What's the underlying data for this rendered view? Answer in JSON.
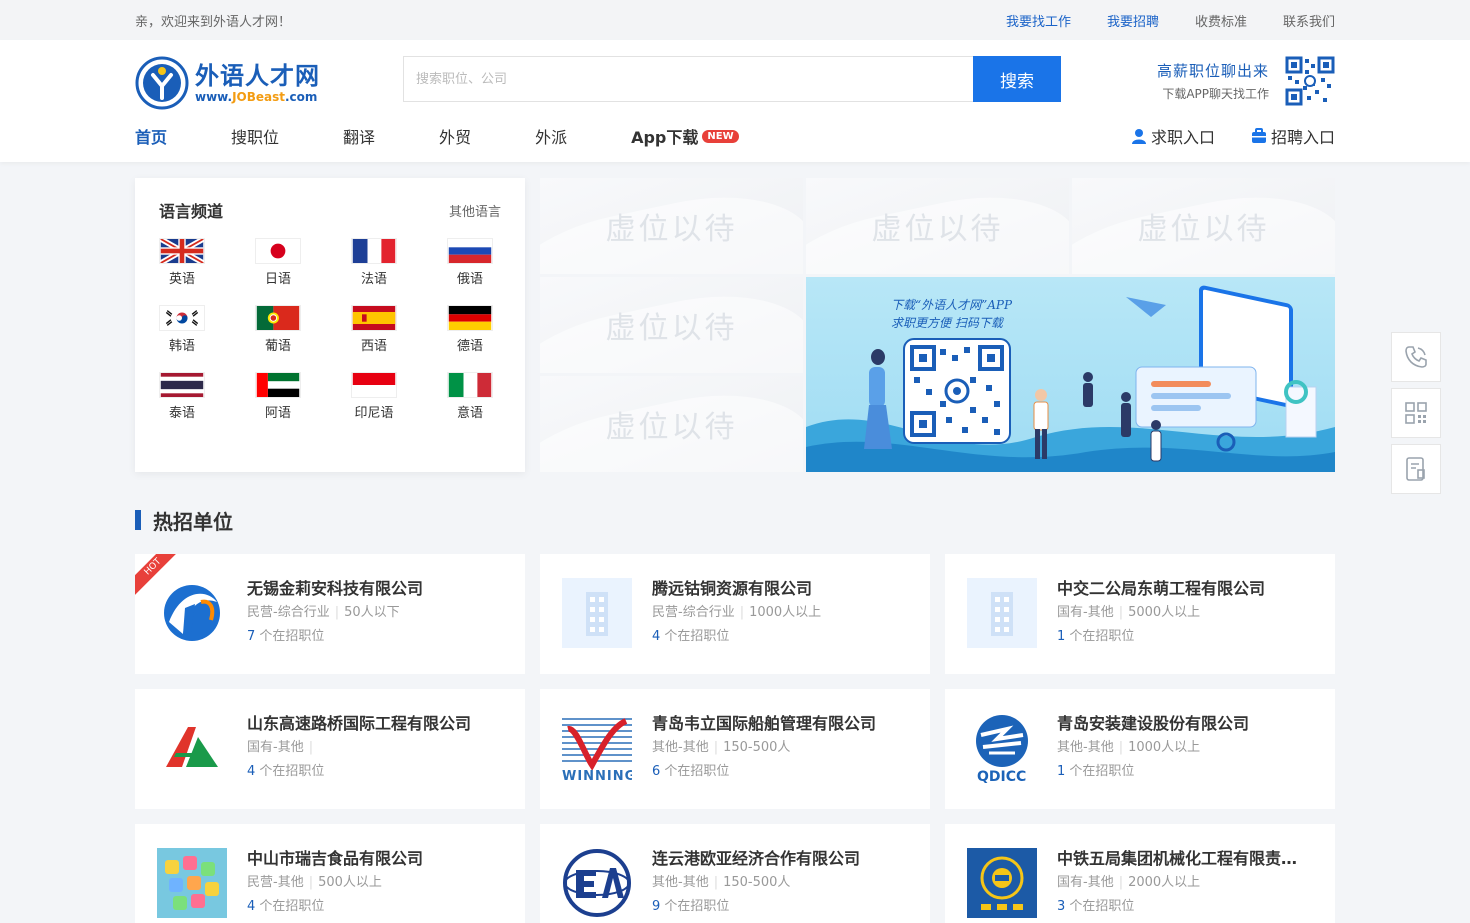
{
  "topbar": {
    "welcome": "亲，欢迎来到外语人才网！",
    "links": [
      "我要找工作",
      "我要招聘",
      "收费标准",
      "联系我们"
    ]
  },
  "header": {
    "logo_name": "外语人才网",
    "logo_url_prefix": "www.",
    "logo_url_brand": "JOBeast",
    "logo_url_suffix": ".com",
    "search_placeholder": "搜索职位、公司",
    "search_button": "搜索",
    "app_title": "高薪职位聊出来",
    "app_subtitle": "下载APP聊天找工作"
  },
  "nav": {
    "items": [
      "首页",
      "搜职位",
      "翻译",
      "外贸",
      "外派",
      "App下载"
    ],
    "badge": "NEW",
    "right": [
      "求职入口",
      "招聘入口"
    ]
  },
  "languages": {
    "title": "语言频道",
    "more": "其他语言",
    "items": [
      "英语",
      "日语",
      "法语",
      "俄语",
      "韩语",
      "葡语",
      "西语",
      "德语",
      "泰语",
      "阿语",
      "印尼语",
      "意语"
    ]
  },
  "ads": {
    "placeholder": "虚位以待",
    "banner_line1": "下载“外语人才网”APP",
    "banner_line2": "求职更方便  扫码下载"
  },
  "hot": {
    "title": "热招单位",
    "badge": "HOT",
    "jobs_suffix": "个在招职位",
    "companies": [
      {
        "name": "无锡金莉安科技有限公司",
        "type": "民营-综合行业",
        "size": "50人以下",
        "jobs": "7"
      },
      {
        "name": "腾远钴铜资源有限公司",
        "type": "民营-综合行业",
        "size": "1000人以上",
        "jobs": "4"
      },
      {
        "name": "中交二公局东萌工程有限公司",
        "type": "国有-其他",
        "size": "5000人以上",
        "jobs": "1"
      },
      {
        "name": "山东高速路桥国际工程有限公司",
        "type": "国有-其他",
        "size": "",
        "jobs": "4"
      },
      {
        "name": "青岛韦立国际船舶管理有限公司",
        "type": "其他-其他",
        "size": "150-500人",
        "jobs": "6"
      },
      {
        "name": "青岛安装建设股份有限公司",
        "type": "其他-其他",
        "size": "1000人以上",
        "jobs": "1"
      },
      {
        "name": "中山市瑞吉食品有限公司",
        "type": "民营-其他",
        "size": "500人以上",
        "jobs": "4"
      },
      {
        "name": "连云港欧亚经济合作有限公司",
        "type": "其他-其他",
        "size": "150-500人",
        "jobs": "9"
      },
      {
        "name": "中铁五局集团机械化工程有限责任公司",
        "type": "国有-其他",
        "size": "2000人以上",
        "jobs": "3"
      }
    ]
  },
  "colors": {
    "brand": "#1a5eb8",
    "button": "#1a74e8",
    "hot": "#e8403a"
  }
}
